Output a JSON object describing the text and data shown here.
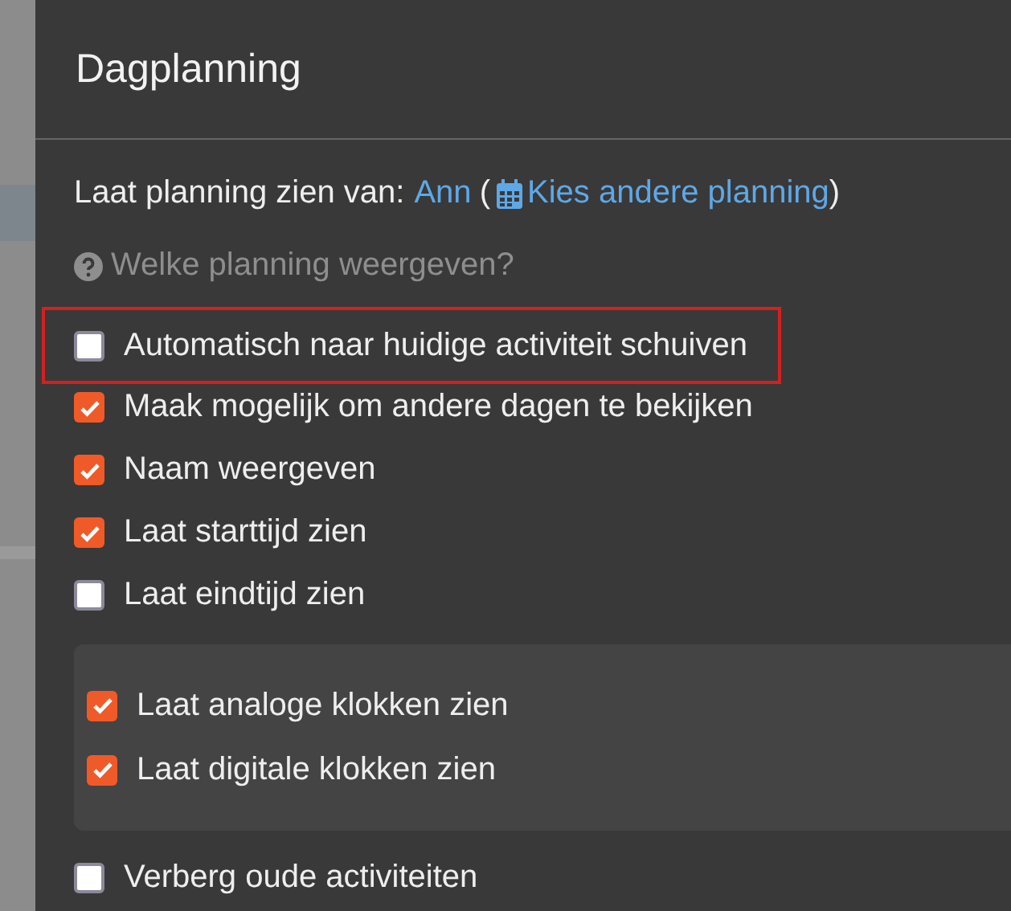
{
  "dialog": {
    "title": "Dagplanning",
    "show_for": {
      "label": "Laat planning zien van:",
      "user": "Ann",
      "open_paren": "(",
      "link": "Kies andere planning",
      "close_paren": ")"
    },
    "help": "Welke planning weergeven?",
    "options": [
      {
        "kind": "checkbox",
        "label": "Automatisch naar huidige activiteit schuiven",
        "checked": false,
        "highlighted": true
      },
      {
        "kind": "checkbox",
        "label": "Maak mogelijk om andere dagen te bekijken",
        "checked": true,
        "highlighted": false
      },
      {
        "kind": "checkbox",
        "label": "Naam weergeven",
        "checked": true,
        "highlighted": false
      },
      {
        "kind": "checkbox",
        "label": "Laat starttijd zien",
        "checked": true,
        "highlighted": false
      },
      {
        "kind": "checkbox",
        "label": "Laat eindtijd zien",
        "checked": false,
        "highlighted": false
      },
      {
        "kind": "group",
        "children": [
          {
            "kind": "checkbox",
            "label": "Laat analoge klokken zien",
            "checked": true,
            "highlighted": false
          },
          {
            "kind": "checkbox",
            "label": "Laat digitale klokken zien",
            "checked": true,
            "highlighted": false
          }
        ]
      },
      {
        "kind": "checkbox",
        "label": "Verberg oude activiteiten",
        "checked": false,
        "highlighted": false
      }
    ]
  }
}
